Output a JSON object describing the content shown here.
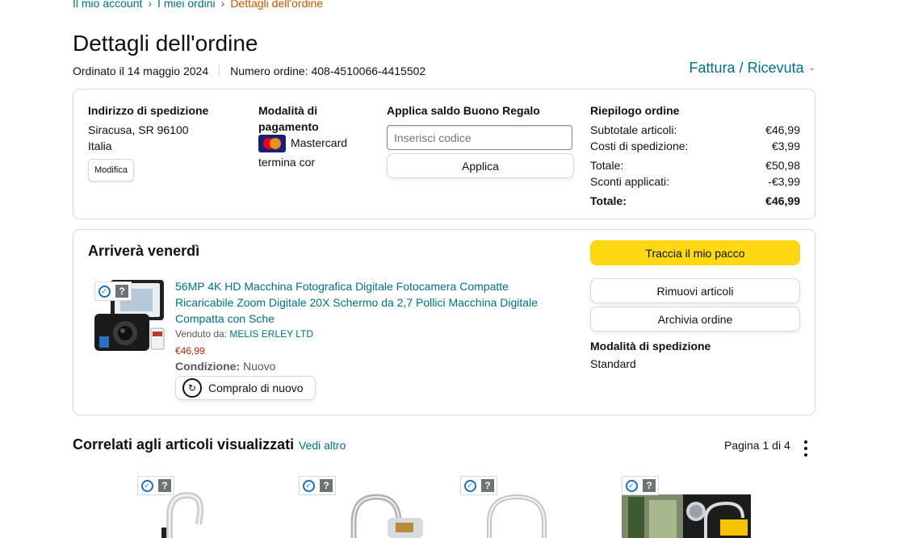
{
  "breadcrumb": {
    "items": [
      "Il mio account",
      "I miei ordini"
    ],
    "current": "Dettagli dell'ordine",
    "separator": "›"
  },
  "page_title": "Dettagli dell'ordine",
  "order_meta": {
    "ordered_on": "Ordinato il 14 maggio 2024",
    "order_number": "Numero ordine: 408-4510066-4415502"
  },
  "invoice_link": "Fattura / Ricevuta",
  "shipping_address": {
    "title": "Indirizzo di spedizione",
    "line1": "Siracusa, SR 96100",
    "line2": "Italia",
    "edit_label": "Modifica"
  },
  "payment": {
    "title": "Modalità di pagamento",
    "card": "Mastercard",
    "ending": "termina cor"
  },
  "gift_card": {
    "title": "Applica saldo Buono Regalo",
    "placeholder": "Inserisci codice",
    "apply_label": "Applica"
  },
  "order_summary": {
    "title": "Riepilogo ordine",
    "rows": [
      {
        "label": "Subtotale articoli:",
        "value": "€46,99"
      },
      {
        "label": "Costi di spedizione:",
        "value": "€3,99"
      },
      {
        "label": "Totale:",
        "value": "€50,98"
      },
      {
        "label": "Sconti applicati:",
        "value": "-€3,99"
      }
    ],
    "grand_total_label": "Totale:",
    "grand_total_value": "€46,99"
  },
  "shipment": {
    "arrival": "Arriverà venerdì",
    "product_title": "56MP 4K HD Macchina Fotografica Digitale Fotocamera Compatte Ricaricabile Zoom Digitale 20X Schermo da 2,7 Pollici Macchina Digitale Compatta con Sche",
    "sold_by_label": "Venduto da:",
    "seller": "MELIS ERLEY LTD",
    "price": "€46,99",
    "condition_label": "Condizione:",
    "condition_value": "Nuovo",
    "buy_again_label": "Compralo di nuovo",
    "track_label": "Traccia il mio pacco",
    "remove_label": "Rimuovi articoli",
    "archive_label": "Archivia ordine",
    "ship_mode_title": "Modalità di spedizione",
    "ship_mode_value": "Standard"
  },
  "related": {
    "title": "Correlati agli articoli visualizzati",
    "see_more": "Vedi altro",
    "pagination": "Pagina 1 di 4"
  },
  "colors": {
    "link": "#007185",
    "accent_orange": "#c45500",
    "price_red": "#b12704",
    "track_button": "#ffd814"
  }
}
